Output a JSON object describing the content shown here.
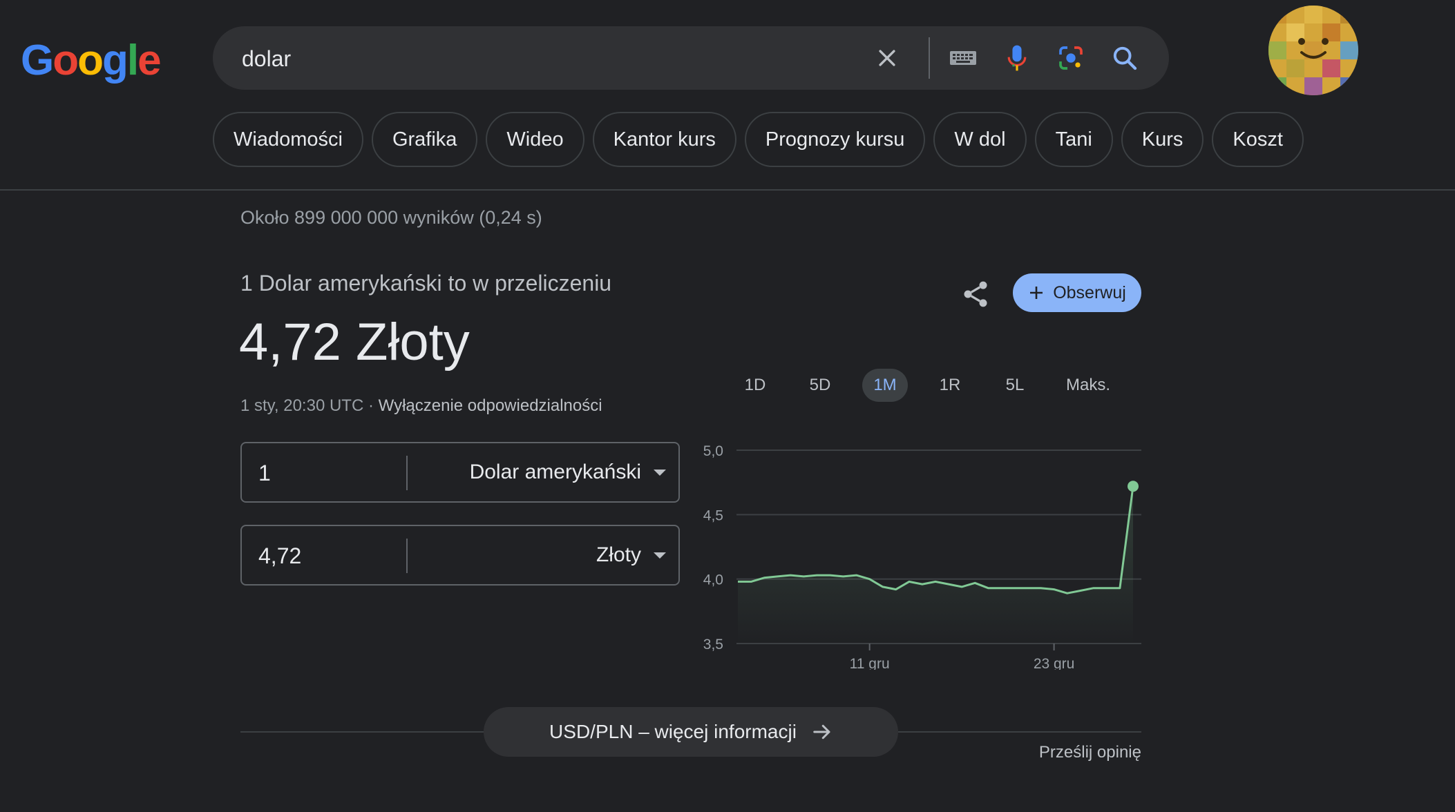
{
  "header": {
    "logo_letters": [
      "G",
      "o",
      "o",
      "g",
      "l",
      "e"
    ],
    "search": {
      "query": "dolar"
    },
    "chips": [
      "Wiadomości",
      "Grafika",
      "Wideo",
      "Kantor kurs",
      "Prognozy kursu",
      "W dol",
      "Tani",
      "Kurs",
      "Koszt"
    ]
  },
  "results": {
    "stats": "Około 899 000 000 wyników (0,24 s)"
  },
  "converter": {
    "subtitle": "1 Dolar amerykański to w przeliczeniu",
    "main_value": "4,72 Złoty",
    "timestamp": "1 sty, 20:30 UTC · ",
    "disclaimer": "Wyłączenie odpowiedzialności",
    "follow_label": "Obserwuj",
    "from": {
      "amount": "1",
      "currency": "Dolar amerykański"
    },
    "to": {
      "amount": "4,72",
      "currency": "Złoty"
    },
    "ranges": [
      "1D",
      "5D",
      "1M",
      "1R",
      "5L",
      "Maks."
    ],
    "active_range": "1M",
    "more_info": "USD/PLN – więcej informacji",
    "feedback": "Prześlij opinię"
  },
  "colors": {
    "background": "#202124",
    "accent": "#8ab4f8",
    "line": "#81c995"
  },
  "chart_data": {
    "type": "line",
    "x": [
      1,
      2,
      3,
      4,
      5,
      6,
      7,
      8,
      9,
      10,
      11,
      12,
      13,
      14,
      15,
      16,
      17,
      18,
      19,
      20,
      21,
      22,
      23,
      24,
      25,
      26,
      27,
      28,
      29,
      30,
      31,
      32,
      33
    ],
    "values": [
      3.98,
      3.98,
      4.01,
      4.02,
      4.03,
      4.02,
      4.03,
      4.03,
      4.02,
      4.03,
      4.0,
      3.94,
      3.92,
      3.98,
      3.96,
      3.98,
      3.96,
      3.94,
      3.97,
      3.93,
      3.93,
      3.93,
      3.93,
      3.93,
      3.92,
      3.89,
      3.91,
      3.93,
      3.93,
      3.93,
      4.72
    ],
    "y_ticks": [
      "5,0",
      "4,5",
      "4,0",
      "3,5"
    ],
    "x_tick_labels": [
      "11 gru",
      "23 gru"
    ],
    "ylim": [
      3.5,
      5.0
    ]
  }
}
